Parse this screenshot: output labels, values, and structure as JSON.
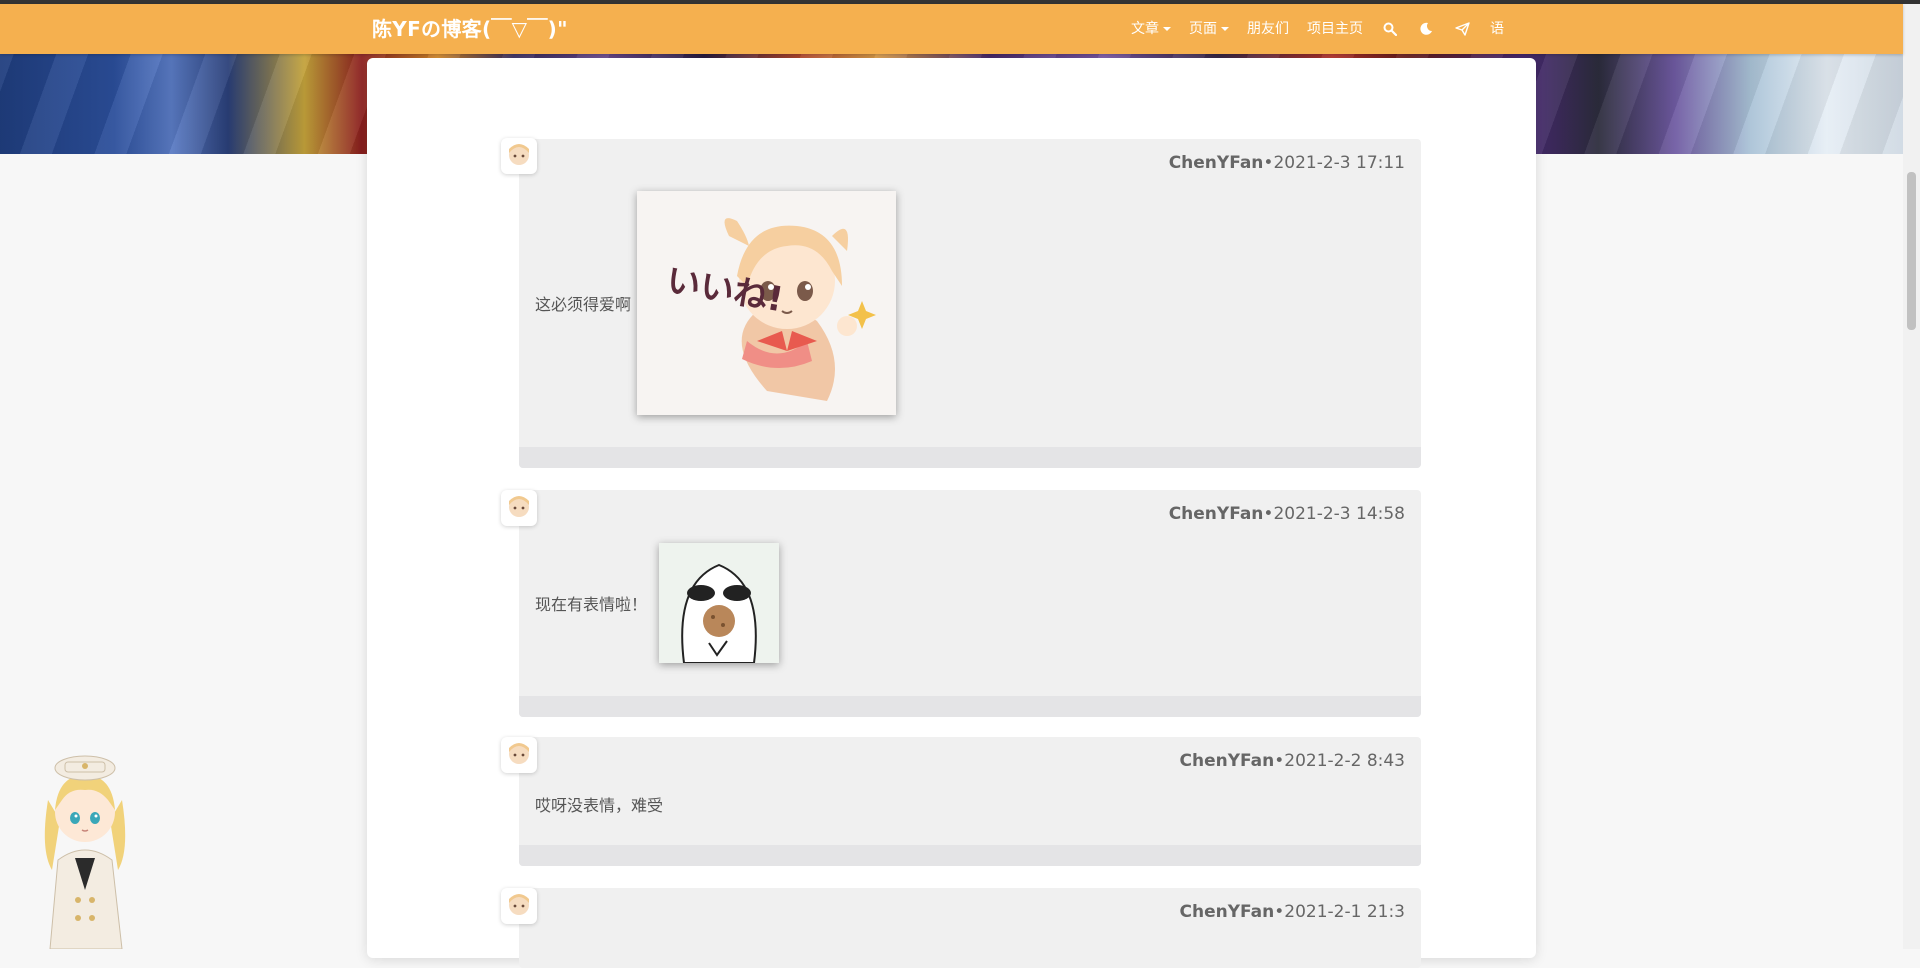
{
  "site": {
    "brand": "陈YFの博客(￣▽￣)\"",
    "accent_color": "#f5b04f"
  },
  "nav": {
    "articles": "文章",
    "pages": "页面",
    "friends": "朋友们",
    "project_home": "项目主页",
    "search_icon": "search-icon",
    "theme_icon": "moon-icon",
    "send_icon": "paper-plane-icon",
    "language": "语"
  },
  "comments": [
    {
      "author": "ChenYFan",
      "sep": "•",
      "time": "2021-2-3 17:11",
      "text": "这必须得爱啊",
      "sticker": "girl-thumbs-up-sticker"
    },
    {
      "author": "ChenYFan",
      "sep": "•",
      "time": "2021-2-3 14:58",
      "text": "现在有表情啦！",
      "sticker": "cookie-eating-face-sticker"
    },
    {
      "author": "ChenYFan",
      "sep": "•",
      "time": "2021-2-2 8:43",
      "text": "哎呀没表情，难受"
    },
    {
      "author": "ChenYFan",
      "sep": "•",
      "time": "2021-2-1 21:3",
      "text": ""
    }
  ],
  "sticker1": {
    "caption": "いいね!"
  }
}
